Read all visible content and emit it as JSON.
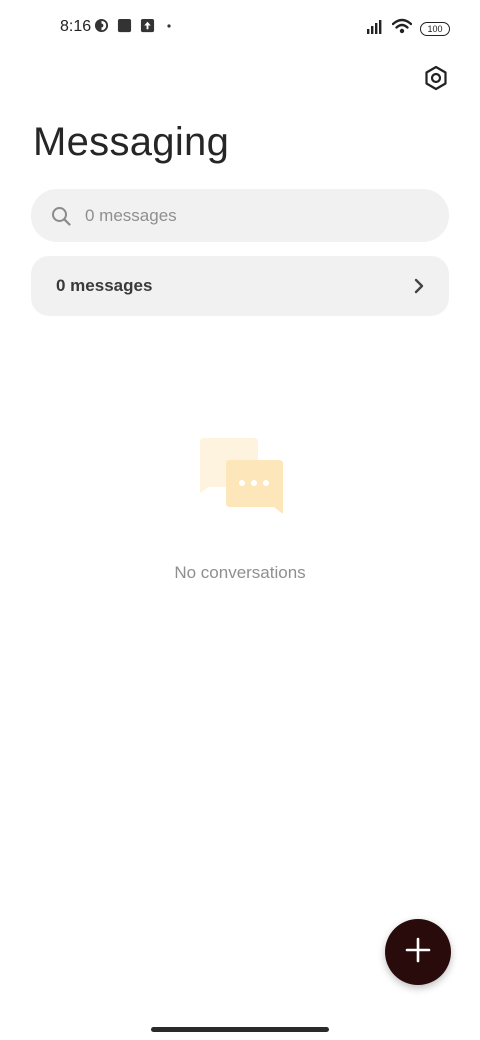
{
  "status_bar": {
    "time": "8:16",
    "battery": "100",
    "left_icons": [
      "app-notification-icon",
      "square-notification-icon",
      "upload-notification-icon",
      "dot-icon"
    ],
    "right_icons": [
      "signal-icon",
      "wifi-icon",
      "battery-icon"
    ]
  },
  "header": {
    "title": "Messaging",
    "settings_icon": "settings-icon"
  },
  "search": {
    "placeholder": "0 messages",
    "icon": "search-icon"
  },
  "messages_row": {
    "label": "0 messages",
    "icon": "chevron-right-icon"
  },
  "empty_state": {
    "text": "No conversations",
    "icon": "chat-bubbles-icon",
    "colors": {
      "back_bubble": "#fdf3de",
      "front_bubble": "#fde7ba"
    }
  },
  "fab": {
    "icon": "plus-icon",
    "color": "#2a0b0b"
  }
}
